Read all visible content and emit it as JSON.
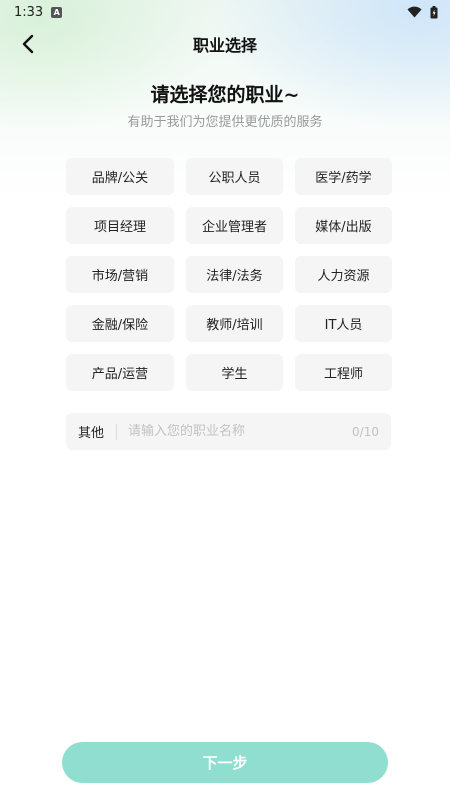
{
  "status_bar": {
    "time": "1:33",
    "app_badge": "A"
  },
  "nav": {
    "title": "职业选择"
  },
  "header": {
    "title": "请选择您的职业~",
    "subtitle": "有助于我们为您提供更优质的服务"
  },
  "professions": [
    "品牌/公关",
    "公职人员",
    "医学/药学",
    "项目经理",
    "企业管理者",
    "媒体/出版",
    "市场/营销",
    "法律/法务",
    "人力资源",
    "金融/保险",
    "教师/培训",
    "IT人员",
    "产品/运营",
    "学生",
    "工程师"
  ],
  "other": {
    "label": "其他",
    "placeholder": "请输入您的职业名称",
    "value": "",
    "counter": "0/10"
  },
  "next_button": {
    "label": "下一步"
  },
  "colors": {
    "accent": "#8fded0",
    "chip_bg": "#f5f5f5"
  }
}
